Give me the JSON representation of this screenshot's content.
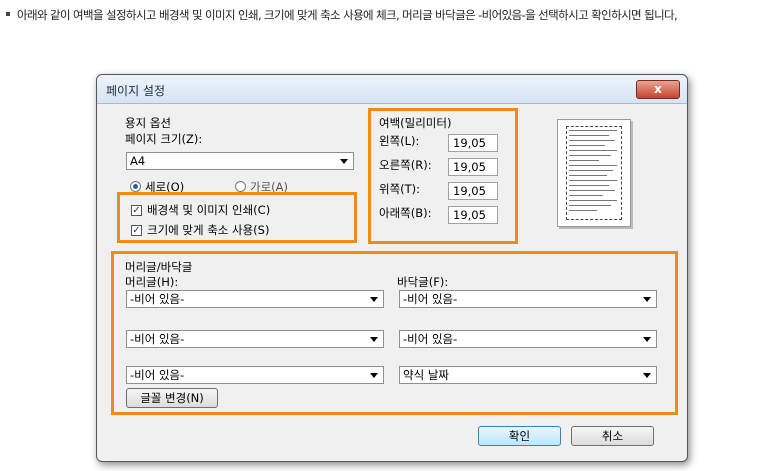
{
  "instruction": "아래와 같이 여백을 설정하시고 배경색 및 이미지 인쇄, 크기에 맞게 축소 사용에 체크, 머리글 바닥글은 -비어있음-을 선택하시고 확인하시면 됩니다,",
  "dialog": {
    "title": "페이지 설정",
    "close_label": "x",
    "paper": {
      "group_label": "용지 옵션",
      "size_label": "페이지 크기(Z):",
      "size_value": "A4",
      "orientation_portrait": "세로(O)",
      "orientation_landscape": "가로(A)",
      "print_background": "배경색 및 이미지 인쇄(C)",
      "shrink_to_fit": "크기에 맞게 축소 사용(S)"
    },
    "margins": {
      "group_label": "여백(밀리미터)",
      "left_label": "왼쪽(L):",
      "left_value": "19,05",
      "right_label": "오른쪽(R):",
      "right_value": "19,05",
      "top_label": "위쪽(T):",
      "top_value": "19,05",
      "bottom_label": "아래쪽(B):",
      "bottom_value": "19,05"
    },
    "headers_footers": {
      "group_label": "머리글/바닥글",
      "header_label": "머리글(H):",
      "footer_label": "바닥글(F):",
      "header1": "-비어 있음-",
      "header2": "-비어 있음-",
      "header3": "-비어 있음-",
      "footer1": "-비어 있음-",
      "footer2": "-비어 있음-",
      "footer3": "약식 날짜",
      "font_button": "글꼴 변경(N)"
    },
    "ok_label": "확인",
    "cancel_label": "취소"
  },
  "colors": {
    "highlight": "#f08a1c",
    "accent": "#3c7fb1"
  }
}
